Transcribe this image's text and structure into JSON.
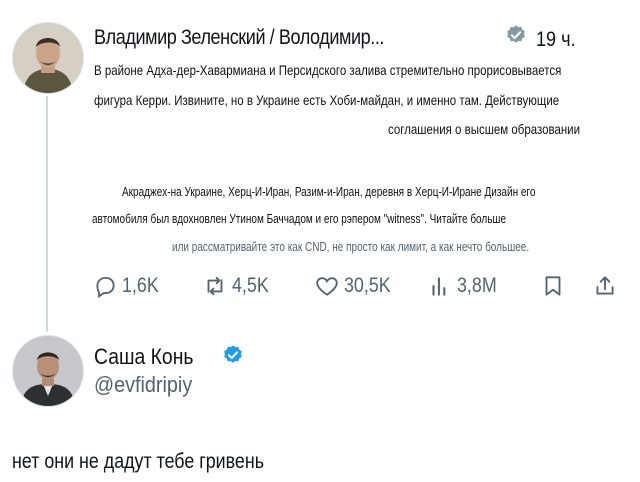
{
  "tweet": {
    "author": "Владимир Зеленский / Володимир...",
    "time": "19 ч.",
    "lines": [
      "В районе Адха-дер-Хавармиана и Персидского залива стремительно прорисовывается",
      "фигура Керри. Извините, но в Украине есть Хоби-майдан, и именно там. Действующие",
      "соглашения о высшем образовании",
      "Акраджеx-на Украине, Херц-И-Иран, Разим-и-Иран, деревня в Херц-И-Иране Дизайн его",
      "автомобиля был вдохновлен Утином Баччадом и его рэпером \"witness\". Читайте больше",
      "или рассматривайте это как CND, не просто как лимит, а как нечто большее."
    ],
    "stats": {
      "replies": "1,6K",
      "retweets": "4,5K",
      "likes": "30,5K",
      "views": "3,8M"
    },
    "icons": {
      "reply": "reply-icon",
      "retweet": "retweet-icon",
      "like": "heart-icon",
      "views": "views-chart-icon",
      "bookmark": "bookmark-icon",
      "share": "share-icon",
      "verified": "verified-badge-icon"
    }
  },
  "reply": {
    "name": "Саша Конь",
    "handle": "@evfidripiy",
    "text": "нет они не дадут тебе гривень"
  },
  "colors": {
    "verified_badge": "#1d9bf0",
    "verified_badge_first": "#8899a6",
    "text_secondary": "#536471",
    "thread_line": "#cfd9de"
  }
}
